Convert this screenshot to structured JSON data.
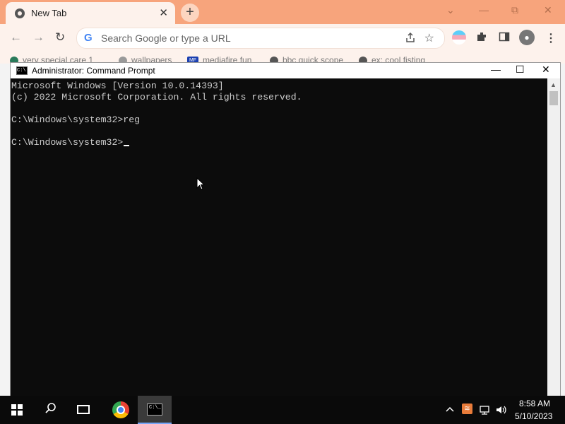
{
  "browser": {
    "tab": {
      "title": "New Tab",
      "close": "✕"
    },
    "new_tab": "+",
    "window_controls": {
      "dropdown": "⌄",
      "minimize": "—",
      "restore": "⧉",
      "close": "✕"
    },
    "nav": {
      "back": "←",
      "forward": "→",
      "reload": "↻"
    },
    "omnibox": {
      "logo": "G",
      "placeholder": "Search Google or type a URL"
    },
    "bookmarks": [
      "very special care 1",
      "wallpapers",
      "mediafire fun",
      "bbc quick scope",
      "ex: cool fisting"
    ],
    "bookmark_badge": "MF"
  },
  "cmd": {
    "title": "Administrator: Command Prompt",
    "icon_text": "C:\\",
    "controls": {
      "minimize": "—",
      "maximize": "☐",
      "close": "✕"
    },
    "lines": [
      "Microsoft Windows [Version 10.0.14393]",
      "(c) 2022 Microsoft Corporation. All rights reserved.",
      "",
      "C:\\Windows\\system32>reg",
      "",
      "C:\\Windows\\system32>"
    ]
  },
  "taskbar": {
    "cmd_icon_text": "C:\\_",
    "tray": {
      "chevron": "^",
      "network": "▭",
      "volume": "🔊"
    },
    "time": "8:58 AM",
    "date": "5/10/2023"
  },
  "colors": {
    "chrome_frame": "#f7a47c",
    "chrome_toolbar": "#fdf2ec",
    "console_bg": "#0c0c0c",
    "console_text": "#cccccc",
    "taskbar": "#0a0a0a"
  }
}
